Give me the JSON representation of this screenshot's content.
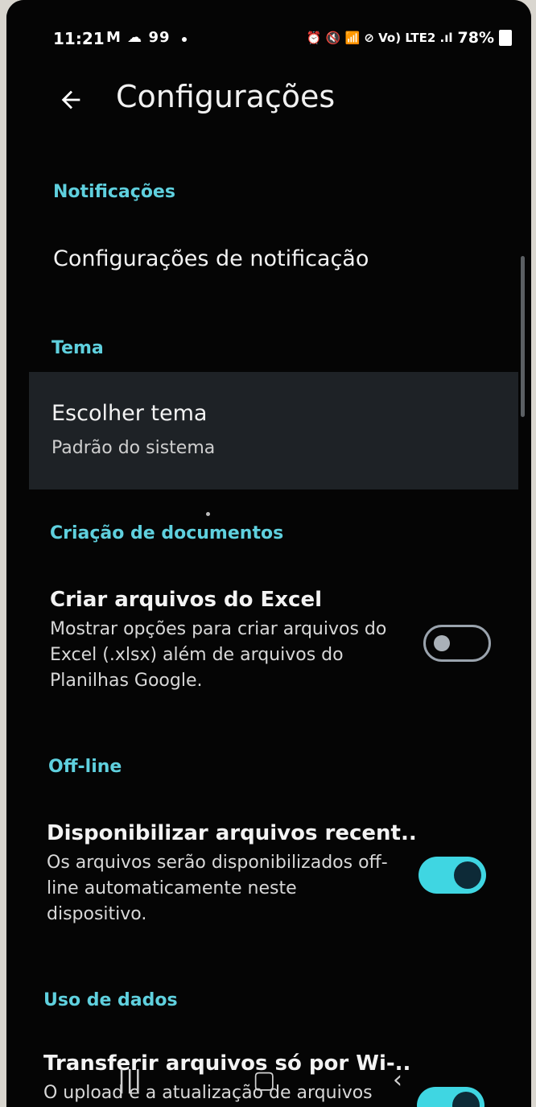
{
  "status_bar": {
    "time": "11:21",
    "left_icons": "M ☁ 99",
    "right_icons": "⏰ 🔇 📶 ⊘ Vo) LTE2 .ıl",
    "battery": "78%"
  },
  "app_bar": {
    "back_icon": "arrow-left-icon",
    "title": "Configurações"
  },
  "sections": {
    "notifications": {
      "header": "Notificações",
      "item": "Configurações de notificação"
    },
    "theme": {
      "header": "Tema",
      "item_title": "Escolher tema",
      "item_value": "Padrão do sistema"
    },
    "doc_creation": {
      "header": "Criação de documentos",
      "title": "Criar arquivos do Excel",
      "description": "Mostrar opções para criar arquivos do Excel (.xlsx) além de arquivos do Planilhas Google.",
      "enabled": false
    },
    "offline": {
      "header": "Off-line",
      "title": "Disponibilizar arquivos recent..",
      "description": "Os arquivos serão disponibilizados off-line automaticamente neste dispositivo.",
      "enabled": true
    },
    "data_usage": {
      "header": "Uso de dados",
      "title": "Transferir arquivos só por Wi-..",
      "description": "O upload e a atualização de arquivos",
      "enabled": true
    }
  },
  "nav_bar": {
    "recents_icon": "|||",
    "home_icon": "▢",
    "back_icon": "‹"
  },
  "colors": {
    "accent": "#5fd0de",
    "toggle_on": "#3fd6e2",
    "background": "#050505"
  }
}
